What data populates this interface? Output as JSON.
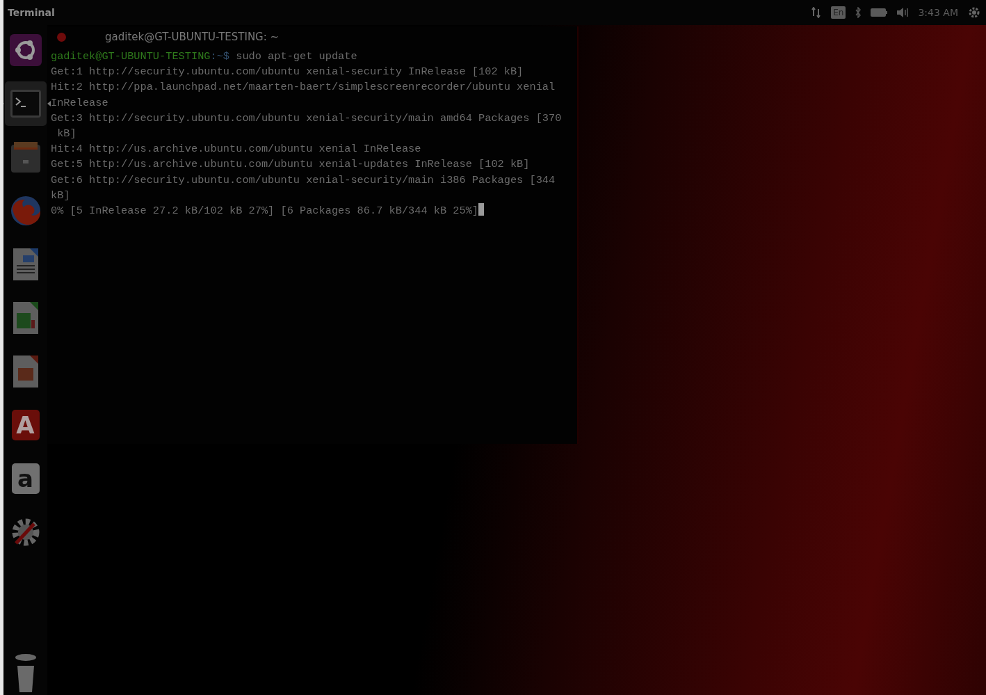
{
  "top_bar": {
    "app_title": "Terminal",
    "keyboard_layout": "En",
    "clock": "3:43 AM"
  },
  "launcher": [
    {
      "kind": "dash",
      "selected": false
    },
    {
      "kind": "terminal",
      "selected": true
    },
    {
      "kind": "files",
      "selected": false
    },
    {
      "kind": "browser",
      "selected": false
    },
    {
      "kind": "writer",
      "selected": false
    },
    {
      "kind": "calc",
      "selected": false
    },
    {
      "kind": "impress",
      "selected": false
    },
    {
      "kind": "software",
      "selected": false,
      "glyph": "A"
    },
    {
      "kind": "amazon",
      "selected": false,
      "glyph": "a"
    },
    {
      "kind": "settings",
      "selected": false
    },
    {
      "kind": "trash",
      "selected": false
    }
  ],
  "terminal": {
    "title": "gaditek@GT-UBUNTU-TESTING: ~",
    "lines": [
      {
        "kind": "prompt",
        "user": "gaditek@GT-UBUNTU-TESTING",
        "path": ":~$",
        "command": " sudo apt-get update"
      },
      {
        "kind": "output",
        "text": "Get:1 http://security.ubuntu.com/ubuntu xenial-security InRelease [102 kB]"
      },
      {
        "kind": "output",
        "text": "Hit:2 http://ppa.launchpad.net/maarten-baert/simplescreenrecorder/ubuntu xenial"
      },
      {
        "kind": "output",
        "text": "InRelease"
      },
      {
        "kind": "output",
        "text": "Get:3 http://security.ubuntu.com/ubuntu xenial-security/main amd64 Packages [370"
      },
      {
        "kind": "output",
        "text": " kB]"
      },
      {
        "kind": "output",
        "text": "Hit:4 http://us.archive.ubuntu.com/ubuntu xenial InRelease"
      },
      {
        "kind": "output",
        "text": "Get:5 http://us.archive.ubuntu.com/ubuntu xenial-updates InRelease [102 kB]"
      },
      {
        "kind": "output",
        "text": "Get:6 http://security.ubuntu.com/ubuntu xenial-security/main i386 Packages [344"
      },
      {
        "kind": "output",
        "text": "kB]"
      },
      {
        "kind": "progress",
        "text": "0% [5 InRelease 27.2 kB/102 kB 27%] [6 Packages 86.7 kB/344 kB 25%]"
      }
    ]
  }
}
